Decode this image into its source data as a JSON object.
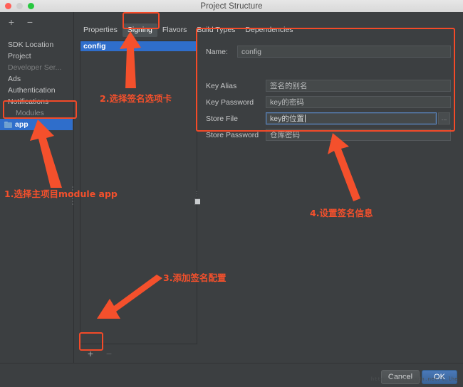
{
  "window": {
    "title": "Project Structure",
    "traffic_lights": [
      "close-red",
      "minimize-gray",
      "zoom-green"
    ]
  },
  "sidebar": {
    "toolbar": {
      "add_label": "+",
      "remove_label": "−"
    },
    "items": [
      {
        "label": "SDK Location",
        "state": "normal"
      },
      {
        "label": "Project",
        "state": "normal"
      },
      {
        "label": "Developer Ser...",
        "state": "dim"
      },
      {
        "label": "Ads",
        "state": "normal"
      },
      {
        "label": "Authentication",
        "state": "normal"
      },
      {
        "label": "Notifications",
        "state": "normal"
      },
      {
        "label": "Modules",
        "state": "group"
      },
      {
        "label": "app",
        "state": "selected",
        "icon": "folder-icon"
      }
    ]
  },
  "tabs": [
    {
      "label": "Properties",
      "active": false
    },
    {
      "label": "Signing",
      "active": true
    },
    {
      "label": "Flavors",
      "active": false
    },
    {
      "label": "Build Types",
      "active": false
    },
    {
      "label": "Dependencies",
      "active": false
    }
  ],
  "config_list": {
    "items": [
      {
        "label": "config",
        "selected": true
      }
    ],
    "toolbar": {
      "add_label": "+",
      "remove_label": "−"
    }
  },
  "form": {
    "name_label": "Name:",
    "name_value": "config",
    "fields": [
      {
        "label": "Key Alias",
        "value": "签名的别名",
        "focused": false,
        "browse": false
      },
      {
        "label": "Key Password",
        "value": "key的密码",
        "focused": false,
        "browse": false
      },
      {
        "label": "Store File",
        "value": "key的位置",
        "focused": true,
        "browse": true,
        "browse_label": "..."
      },
      {
        "label": "Store Password",
        "value": "仓库密码",
        "focused": false,
        "browse": false
      }
    ]
  },
  "footer": {
    "cancel_label": "Cancel",
    "ok_label": "OK",
    "watermark": "http://blog.csdn.net/l_lhe"
  },
  "annotations": [
    {
      "id": 1,
      "text": "1.选择主项目module app"
    },
    {
      "id": 2,
      "text": "2.选择签名选项卡"
    },
    {
      "id": 3,
      "text": "3.添加签名配置"
    },
    {
      "id": 4,
      "text": "4.设置签名信息"
    }
  ],
  "colors": {
    "annotation": "#f4502c",
    "selection": "#2f6ecb",
    "panel_bg": "#3c3f41",
    "ok_button": "#3a6498"
  }
}
